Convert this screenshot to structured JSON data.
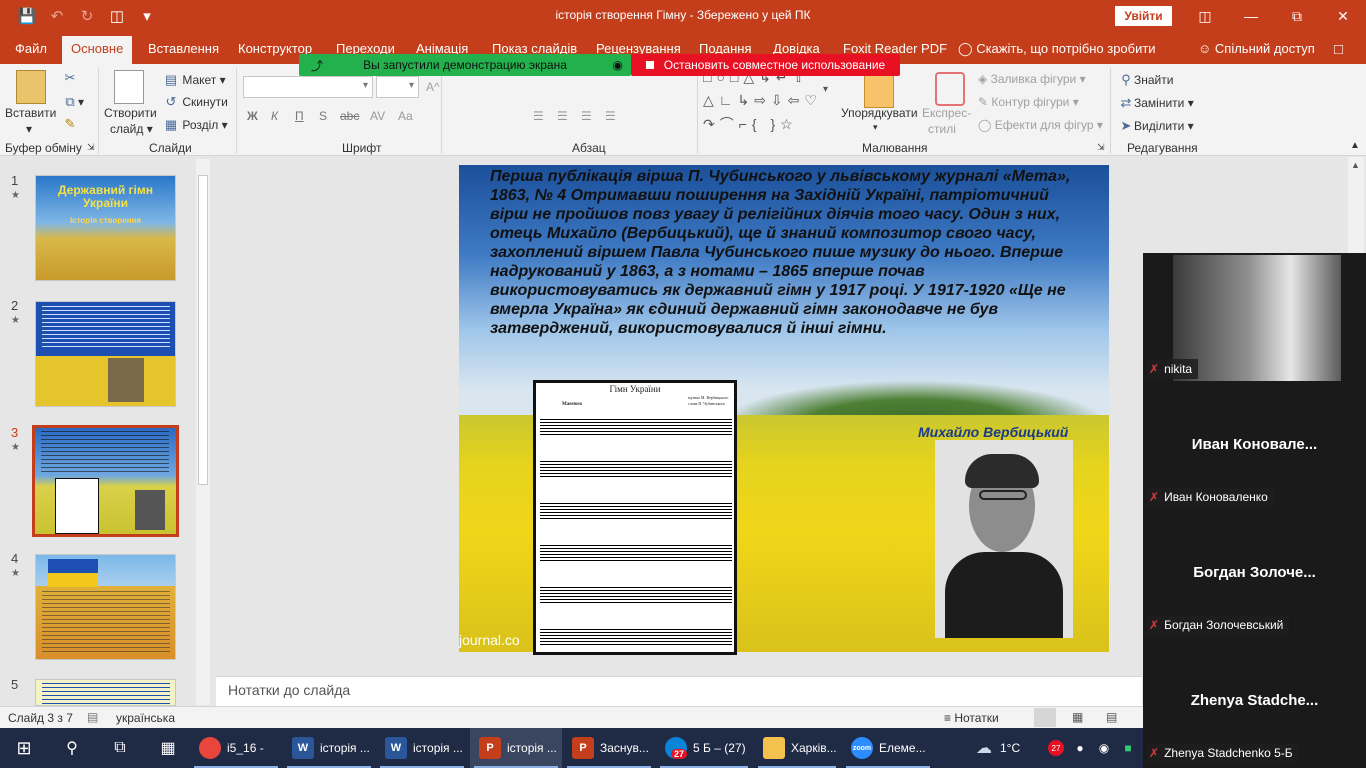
{
  "titlebar": {
    "title": "історія створення Гімну  -  Збережено у цей ПК",
    "signin": "Увійти"
  },
  "tabs": [
    "Файл",
    "Основне",
    "Вставлення",
    "Конструктор",
    "Переходи",
    "Анімація",
    "Показ слайдів",
    "Рецензування",
    "Подання",
    "Довідка",
    "Foxit Reader PDF"
  ],
  "tell_me": "Скажіть, що потрібно зробити",
  "share": "Спільний доступ",
  "share_banner": {
    "green": "Вы запустили демонстрацию экрана",
    "red": "Остановить совместное использование"
  },
  "ribbon": {
    "clipboard": {
      "paste": "Вставити",
      "label": "Буфер обміну"
    },
    "slides": {
      "new_slide_1": "Створити",
      "new_slide_2": "слайд",
      "layout": "Макет",
      "reset": "Скинути",
      "section": "Розділ",
      "label": "Слайди"
    },
    "font": {
      "bold": "Ж",
      "italic": "К",
      "underline": "П",
      "strike": "S",
      "label": "Шрифт"
    },
    "paragraph": {
      "label": "Абзац"
    },
    "drawing": {
      "arrange": "Упорядкувати",
      "quick_styles_1": "Експрес-",
      "quick_styles_2": "стилі",
      "fill": "Заливка фігури",
      "outline": "Контур фігури",
      "effects": "Ефекти для фігур",
      "label": "Малювання"
    },
    "editing": {
      "find": "Знайти",
      "replace": "Замінити",
      "select": "Виділити",
      "label": "Редагування"
    }
  },
  "thumbnails": [
    {
      "num": "1",
      "title": "Державний гімн України",
      "subtitle": "Історія створення"
    },
    {
      "num": "2"
    },
    {
      "num": "3"
    },
    {
      "num": "4"
    },
    {
      "num": "5"
    }
  ],
  "slide": {
    "body": "Перша публікація вірша П. Чубинського у львівському журналі «Мета», 1863, № 4 Отримавши поширення на Західній Україні, патріотичний вірш не пройшов повз увагу й релігійних діячів того часу. Один з них, отець Михайло (Вербицький), ще й знаний композитор свого часу, захоплений віршем Павла Чубинського пише музику до нього. Вперше надрукований у 1863, а з нотами – 1865 вперше почав використовуватись як державний гімн у 1917 році. У 1917-1920 «Ще не вмерла Україна» як єдиний державний гімн законодавче не був затверджений, використовувалися й інші гімни.",
    "caption": "Михайло Вербицький",
    "watermark": "journal.co",
    "sheet": {
      "title": "Гімн України",
      "tempo": "Maestoso",
      "credits_1": "музика М. Вербицького",
      "credits_2": "слова П. Чубинського"
    }
  },
  "notes_placeholder": "Нотатки до слайда",
  "status": {
    "slide": "Слайд 3 з 7",
    "language": "українська",
    "notes": "Нотатки"
  },
  "taskbar": {
    "items": [
      {
        "label": "i5_16 -",
        "color": "#e8453c"
      },
      {
        "label": "історія ...",
        "color": "#2b579a"
      },
      {
        "label": "історія ...",
        "color": "#2b579a"
      },
      {
        "label": "історія ...",
        "color": "#c43e1c"
      },
      {
        "label": "Заснув...",
        "color": "#c43e1c"
      },
      {
        "label": "5 Б – (27)",
        "color": "#0a84d6"
      },
      {
        "label": "Харків...",
        "color": "#f2c14e"
      },
      {
        "label": "Елеме...",
        "color": "#2d8cff"
      }
    ],
    "badge": "27",
    "temperature": "1°C"
  },
  "participants": [
    {
      "name": "nikita",
      "big": ""
    },
    {
      "name": "Иван Коноваленко",
      "big": "Иван  Коновале..."
    },
    {
      "name": "Богдан Золочевський",
      "big": "Богдан  Золоче..."
    },
    {
      "name": "Zhenya Stadchenko 5-Б",
      "big": "Zhenya  Stadche..."
    }
  ]
}
